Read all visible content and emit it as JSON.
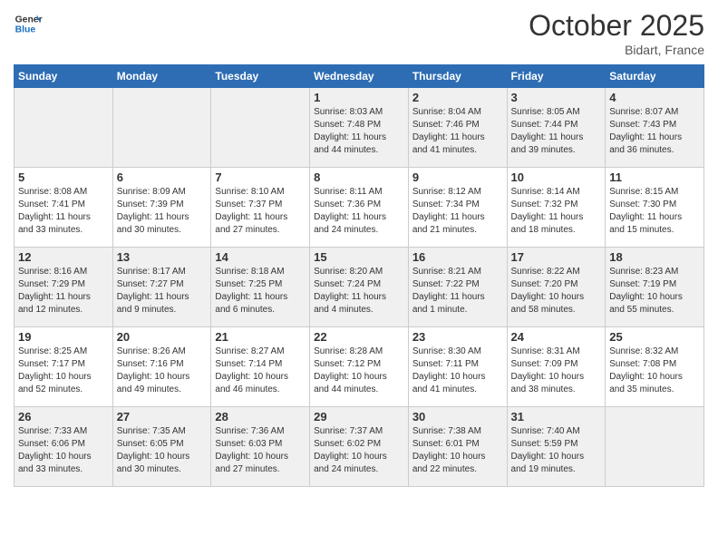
{
  "logo": {
    "line1": "General",
    "line2": "Blue"
  },
  "title": "October 2025",
  "location": "Bidart, France",
  "days_of_week": [
    "Sunday",
    "Monday",
    "Tuesday",
    "Wednesday",
    "Thursday",
    "Friday",
    "Saturday"
  ],
  "weeks": [
    [
      {
        "day": "",
        "text": ""
      },
      {
        "day": "",
        "text": ""
      },
      {
        "day": "",
        "text": ""
      },
      {
        "day": "1",
        "text": "Sunrise: 8:03 AM\nSunset: 7:48 PM\nDaylight: 11 hours\nand 44 minutes."
      },
      {
        "day": "2",
        "text": "Sunrise: 8:04 AM\nSunset: 7:46 PM\nDaylight: 11 hours\nand 41 minutes."
      },
      {
        "day": "3",
        "text": "Sunrise: 8:05 AM\nSunset: 7:44 PM\nDaylight: 11 hours\nand 39 minutes."
      },
      {
        "day": "4",
        "text": "Sunrise: 8:07 AM\nSunset: 7:43 PM\nDaylight: 11 hours\nand 36 minutes."
      }
    ],
    [
      {
        "day": "5",
        "text": "Sunrise: 8:08 AM\nSunset: 7:41 PM\nDaylight: 11 hours\nand 33 minutes."
      },
      {
        "day": "6",
        "text": "Sunrise: 8:09 AM\nSunset: 7:39 PM\nDaylight: 11 hours\nand 30 minutes."
      },
      {
        "day": "7",
        "text": "Sunrise: 8:10 AM\nSunset: 7:37 PM\nDaylight: 11 hours\nand 27 minutes."
      },
      {
        "day": "8",
        "text": "Sunrise: 8:11 AM\nSunset: 7:36 PM\nDaylight: 11 hours\nand 24 minutes."
      },
      {
        "day": "9",
        "text": "Sunrise: 8:12 AM\nSunset: 7:34 PM\nDaylight: 11 hours\nand 21 minutes."
      },
      {
        "day": "10",
        "text": "Sunrise: 8:14 AM\nSunset: 7:32 PM\nDaylight: 11 hours\nand 18 minutes."
      },
      {
        "day": "11",
        "text": "Sunrise: 8:15 AM\nSunset: 7:30 PM\nDaylight: 11 hours\nand 15 minutes."
      }
    ],
    [
      {
        "day": "12",
        "text": "Sunrise: 8:16 AM\nSunset: 7:29 PM\nDaylight: 11 hours\nand 12 minutes."
      },
      {
        "day": "13",
        "text": "Sunrise: 8:17 AM\nSunset: 7:27 PM\nDaylight: 11 hours\nand 9 minutes."
      },
      {
        "day": "14",
        "text": "Sunrise: 8:18 AM\nSunset: 7:25 PM\nDaylight: 11 hours\nand 6 minutes."
      },
      {
        "day": "15",
        "text": "Sunrise: 8:20 AM\nSunset: 7:24 PM\nDaylight: 11 hours\nand 4 minutes."
      },
      {
        "day": "16",
        "text": "Sunrise: 8:21 AM\nSunset: 7:22 PM\nDaylight: 11 hours\nand 1 minute."
      },
      {
        "day": "17",
        "text": "Sunrise: 8:22 AM\nSunset: 7:20 PM\nDaylight: 10 hours\nand 58 minutes."
      },
      {
        "day": "18",
        "text": "Sunrise: 8:23 AM\nSunset: 7:19 PM\nDaylight: 10 hours\nand 55 minutes."
      }
    ],
    [
      {
        "day": "19",
        "text": "Sunrise: 8:25 AM\nSunset: 7:17 PM\nDaylight: 10 hours\nand 52 minutes."
      },
      {
        "day": "20",
        "text": "Sunrise: 8:26 AM\nSunset: 7:16 PM\nDaylight: 10 hours\nand 49 minutes."
      },
      {
        "day": "21",
        "text": "Sunrise: 8:27 AM\nSunset: 7:14 PM\nDaylight: 10 hours\nand 46 minutes."
      },
      {
        "day": "22",
        "text": "Sunrise: 8:28 AM\nSunset: 7:12 PM\nDaylight: 10 hours\nand 44 minutes."
      },
      {
        "day": "23",
        "text": "Sunrise: 8:30 AM\nSunset: 7:11 PM\nDaylight: 10 hours\nand 41 minutes."
      },
      {
        "day": "24",
        "text": "Sunrise: 8:31 AM\nSunset: 7:09 PM\nDaylight: 10 hours\nand 38 minutes."
      },
      {
        "day": "25",
        "text": "Sunrise: 8:32 AM\nSunset: 7:08 PM\nDaylight: 10 hours\nand 35 minutes."
      }
    ],
    [
      {
        "day": "26",
        "text": "Sunrise: 7:33 AM\nSunset: 6:06 PM\nDaylight: 10 hours\nand 33 minutes."
      },
      {
        "day": "27",
        "text": "Sunrise: 7:35 AM\nSunset: 6:05 PM\nDaylight: 10 hours\nand 30 minutes."
      },
      {
        "day": "28",
        "text": "Sunrise: 7:36 AM\nSunset: 6:03 PM\nDaylight: 10 hours\nand 27 minutes."
      },
      {
        "day": "29",
        "text": "Sunrise: 7:37 AM\nSunset: 6:02 PM\nDaylight: 10 hours\nand 24 minutes."
      },
      {
        "day": "30",
        "text": "Sunrise: 7:38 AM\nSunset: 6:01 PM\nDaylight: 10 hours\nand 22 minutes."
      },
      {
        "day": "31",
        "text": "Sunrise: 7:40 AM\nSunset: 5:59 PM\nDaylight: 10 hours\nand 19 minutes."
      },
      {
        "day": "",
        "text": ""
      }
    ]
  ]
}
